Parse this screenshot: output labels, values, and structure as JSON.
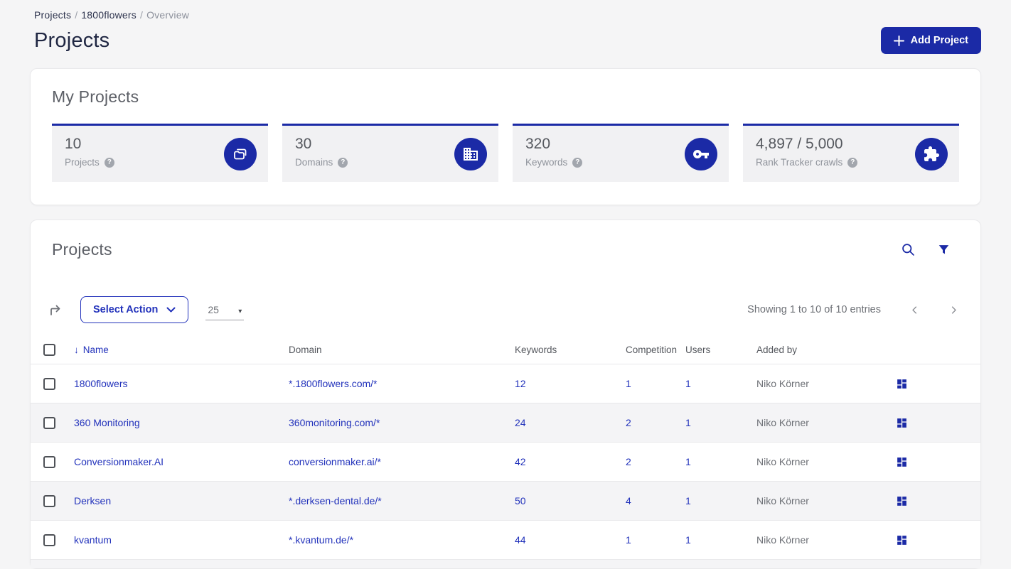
{
  "colors": {
    "primary_blue": "#1b2aa6",
    "link_blue": "#2232bb",
    "page_background": "#f5f5f6",
    "tile_background": "#f1f1f3",
    "heading_navy": "#1f2642",
    "muted_gray": "#6d7076"
  },
  "breadcrumb": {
    "items": [
      "Projects",
      "1800flowers",
      "Overview"
    ],
    "separator": "/"
  },
  "page_header": {
    "title": "Projects",
    "add_project_label": "Add Project"
  },
  "stats_card": {
    "title": "My Projects",
    "help_glyph": "?",
    "tiles": [
      {
        "value": "10",
        "label": "Projects",
        "icon": "projects-stack-icon"
      },
      {
        "value": "30",
        "label": "Domains",
        "icon": "building-icon"
      },
      {
        "value": "320",
        "label": "Keywords",
        "icon": "key-icon"
      },
      {
        "value": "4,897 / 5,000",
        "label": "Rank Tracker crawls",
        "icon": "puzzle-icon"
      }
    ]
  },
  "table_card": {
    "title": "Projects",
    "icons": [
      "search-icon",
      "filter-icon"
    ],
    "toolbar": {
      "select_action_label": "Select Action",
      "page_size": "25",
      "showing_text": "Showing 1 to 10 of 10 entries"
    },
    "sort_glyph": "↓",
    "columns": {
      "name": "Name",
      "domain": "Domain",
      "keywords": "Keywords",
      "competition": "Competition",
      "users": "Users",
      "added_by": "Added by"
    },
    "rows": [
      {
        "name": "1800flowers",
        "domain": "*.1800flowers.com/*",
        "keywords": "12",
        "competition": "1",
        "users": "1",
        "added_by": "Niko Körner"
      },
      {
        "name": "360 Monitoring",
        "domain": "360monitoring.com/*",
        "keywords": "24",
        "competition": "2",
        "users": "1",
        "added_by": "Niko Körner"
      },
      {
        "name": "Conversionmaker.AI",
        "domain": "conversionmaker.ai/*",
        "keywords": "42",
        "competition": "2",
        "users": "1",
        "added_by": "Niko Körner"
      },
      {
        "name": "Derksen",
        "domain": "*.derksen-dental.de/*",
        "keywords": "50",
        "competition": "4",
        "users": "1",
        "added_by": "Niko Körner"
      },
      {
        "name": "kvantum",
        "domain": "*.kvantum.de/*",
        "keywords": "44",
        "competition": "1",
        "users": "1",
        "added_by": "Niko Körner"
      }
    ]
  }
}
